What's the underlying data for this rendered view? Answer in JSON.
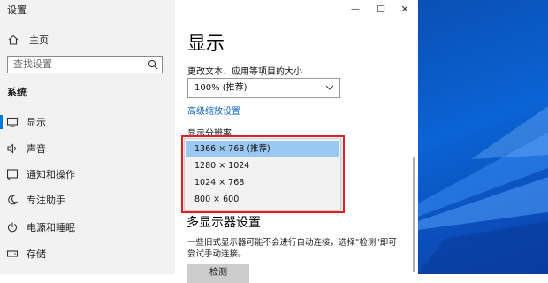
{
  "window": {
    "title": "设置",
    "minimize_glyph": "—",
    "maximize_glyph": "☐",
    "close_glyph": "✕"
  },
  "sidebar": {
    "home": "主页",
    "search_placeholder": "查找设置",
    "section": "系统",
    "items": [
      {
        "label": "显示",
        "icon": "monitor-icon",
        "active": true
      },
      {
        "label": "声音",
        "icon": "speaker-icon"
      },
      {
        "label": "通知和操作",
        "icon": "notification-icon"
      },
      {
        "label": "专注助手",
        "icon": "moon-icon"
      },
      {
        "label": "电源和睡眠",
        "icon": "power-icon"
      },
      {
        "label": "存储",
        "icon": "storage-icon"
      }
    ]
  },
  "main": {
    "title": "显示",
    "scale_label": "更改文本、应用等项目的大小",
    "scale_value": "100% (推荐)",
    "advanced_link": "高级缩放设置",
    "resolution_label": "显示分辨率",
    "resolution_options": [
      "1366 × 768 (推荐)",
      "1280 × 1024",
      "1024 × 768",
      "800 × 600"
    ],
    "selected_resolution_index": 0,
    "multi_display_title": "多显示器设置",
    "multi_display_desc": "一些旧式显示器可能不会进行自动连接，选择\"检测\"即可尝试手动连接。",
    "detect_button": "检测"
  },
  "colors": {
    "accent": "#0078d7",
    "selection": "#99c8f1",
    "highlight_box": "#e02020",
    "link": "#0a66c2"
  }
}
